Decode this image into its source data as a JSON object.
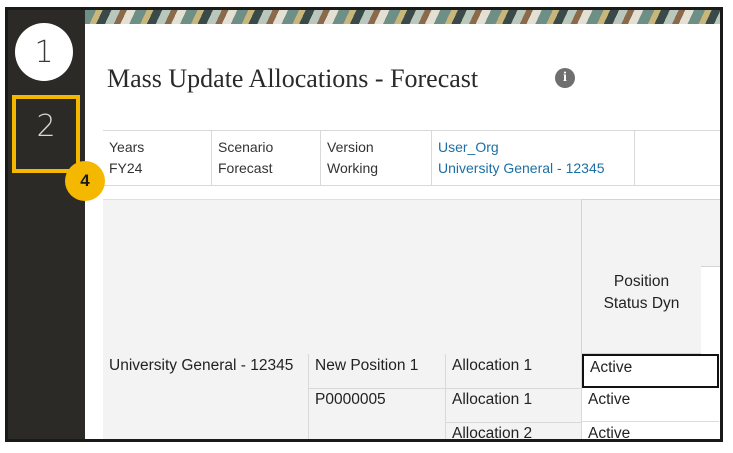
{
  "steps": {
    "step1": "1",
    "step2": "2",
    "callout": "4"
  },
  "page": {
    "title": "Mass Update Allocations - Forecast",
    "info_icon": "i"
  },
  "pov": [
    {
      "label": "Years",
      "value": "FY24"
    },
    {
      "label": "Scenario",
      "value": "Forecast"
    },
    {
      "label": "Version",
      "value": "Working"
    },
    {
      "label": "User_Org",
      "value": "University General - 12345"
    }
  ],
  "grid": {
    "column_header": "Position Status Dyn",
    "rows": [
      {
        "org": "University General - 12345",
        "position": "New Position 1",
        "allocation": "Allocation 1",
        "status": "Active"
      },
      {
        "org": "",
        "position": "P0000005",
        "allocation": "Allocation 1",
        "status": "Active"
      },
      {
        "org": "",
        "position": "",
        "allocation": "Allocation 2",
        "status": "Active"
      }
    ]
  },
  "colors": {
    "accent": "#f5b800",
    "rail": "#2c2a27",
    "link": "#1d6fa5"
  }
}
